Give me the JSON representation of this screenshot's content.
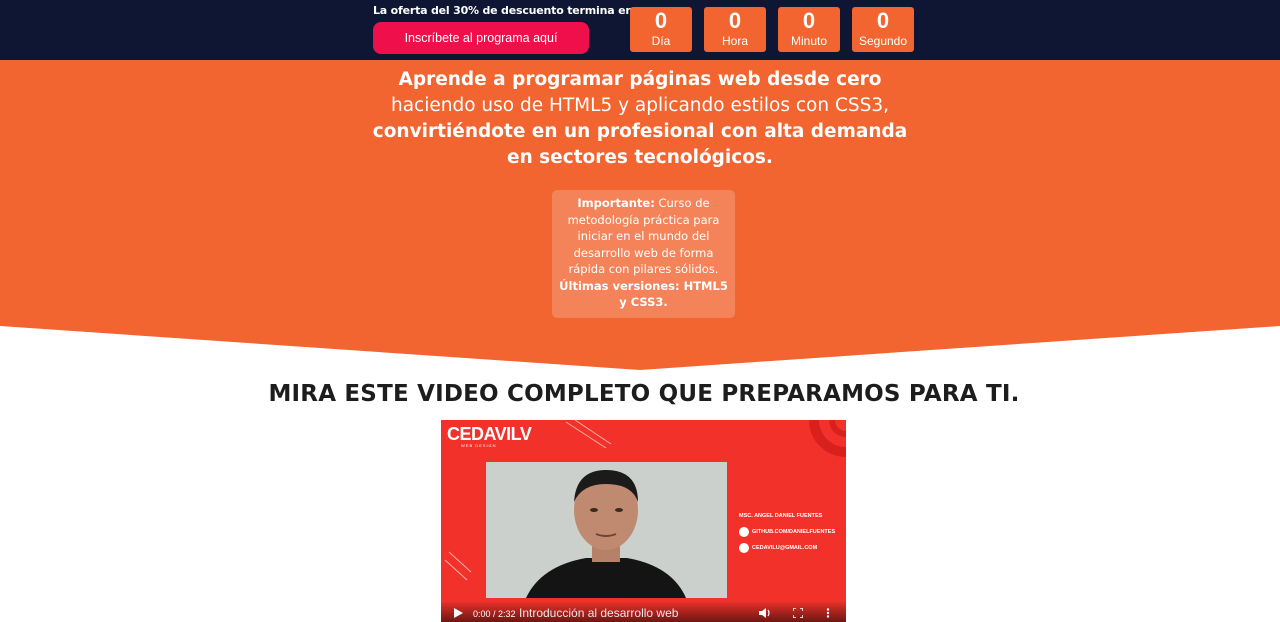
{
  "topbar": {
    "offer_text": "La oferta del 30% de descuento termina en:",
    "cta_label": "Inscríbete al programa aquí",
    "countdown": [
      {
        "value": "0",
        "unit": "Día"
      },
      {
        "value": "0",
        "unit": "Hora"
      },
      {
        "value": "0",
        "unit": "Minuto"
      },
      {
        "value": "0",
        "unit": "Segundo"
      }
    ]
  },
  "hero": {
    "line1": "Aprende a programar páginas web desde cero",
    "line2": "haciendo uso de HTML5 y aplicando estilos con CSS3,",
    "line3": "convirtiéndote en un profesional con alta demanda",
    "line4": "en sectores tecnológicos.",
    "note_label": "Importante:",
    "note_text": "Curso de metodología práctica para iniciar en el mundo del desarrollo web de forma rápida con pilares sólidos.",
    "note_bold": "Últimas versiones: HTML5 y CSS3."
  },
  "video": {
    "section_title": "MIRA ESTE VIDEO COMPLETO QUE PREPARAMOS PARA TI.",
    "logo": "CEDAVILV",
    "logo_sub": "WEB DESIGN",
    "presenter": "MSC. ANGEL DANIEL FUENTES",
    "github": "GITHUB.COM/DANIELFUENTES",
    "email": "CEDAVILU@GMAIL.COM",
    "time": "0:00 / 2:32",
    "caption": "Introducción al desarrollo web"
  },
  "colors": {
    "navy": "#0e1633",
    "orange": "#f26430",
    "pink": "#ee0f4b",
    "video_red": "#f2322a"
  }
}
